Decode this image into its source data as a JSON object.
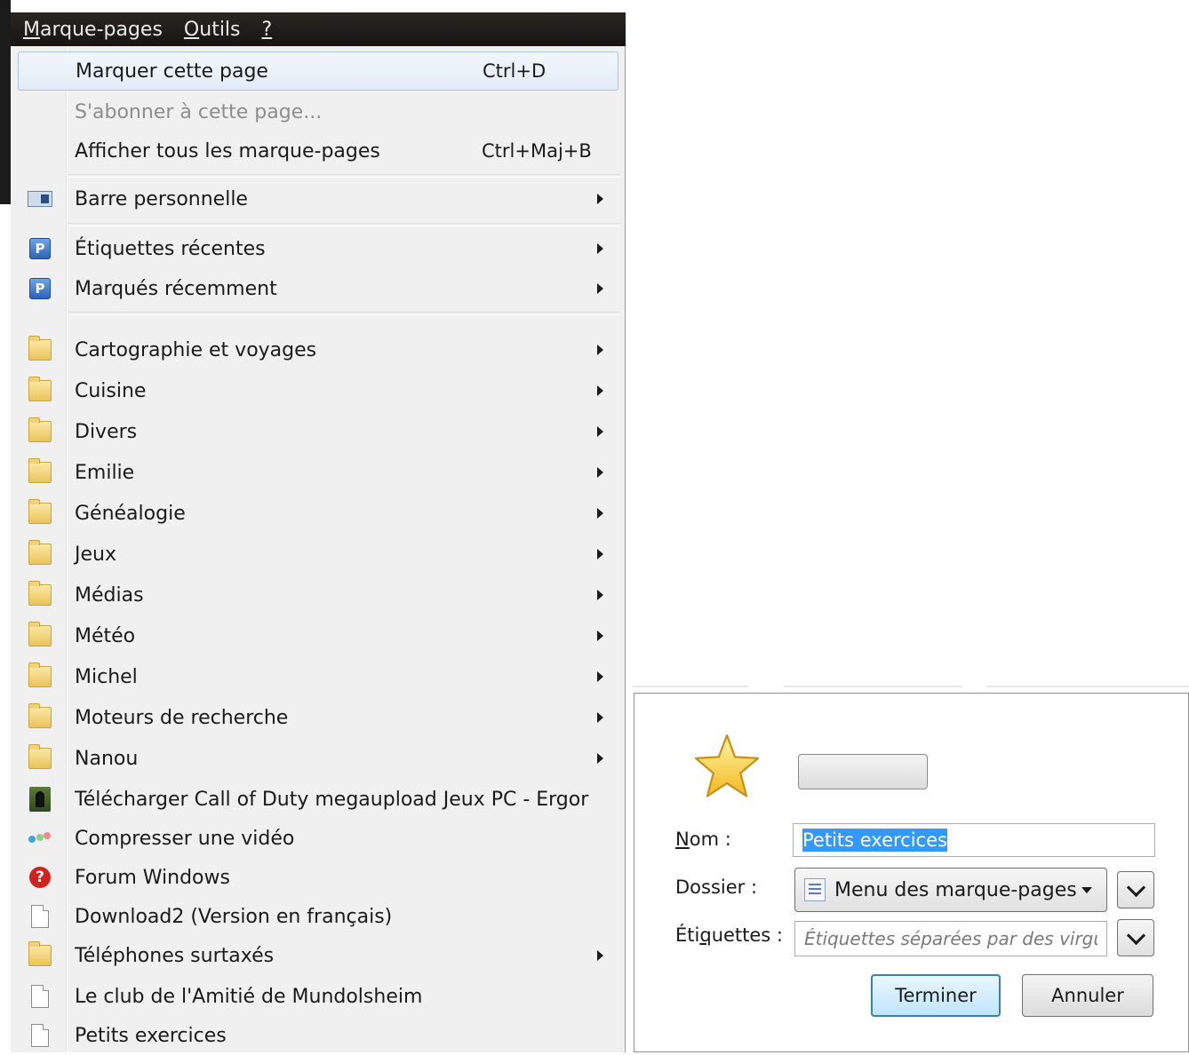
{
  "menubar": {
    "items": [
      {
        "label": "Marque-pages",
        "accel": "M"
      },
      {
        "label": "Outils",
        "accel": "O"
      },
      {
        "label": "?",
        "accel": "?"
      }
    ]
  },
  "menu": {
    "top": [
      {
        "label": "Marquer cette page",
        "shortcut": "Ctrl+D"
      },
      {
        "label": "S'abonner à cette page..."
      },
      {
        "label": "Afficher tous les marque-pages",
        "shortcut": "Ctrl+Maj+B"
      },
      {
        "label": "Barre personnelle"
      },
      {
        "label": "Étiquettes récentes"
      },
      {
        "label": "Marqués récemment"
      }
    ],
    "folders": [
      {
        "label": "Cartographie et voyages"
      },
      {
        "label": "Cuisine"
      },
      {
        "label": "Divers"
      },
      {
        "label": "Emilie"
      },
      {
        "label": "Généalogie"
      },
      {
        "label": "Jeux"
      },
      {
        "label": "Médias"
      },
      {
        "label": "Météo"
      },
      {
        "label": "Michel"
      },
      {
        "label": "Moteurs de recherche"
      },
      {
        "label": "Nanou"
      }
    ],
    "bookmarks": [
      {
        "label": "Télécharger Call of Duty megaupload Jeux PC - Ergor",
        "icon": "person-icon"
      },
      {
        "label": "Compresser une vidéo",
        "icon": "dots-icon"
      },
      {
        "label": "Forum Windows",
        "icon": "forum-icon"
      },
      {
        "label": "Download2 (Version en français)",
        "icon": "page-icon"
      },
      {
        "label": "Téléphones surtaxés",
        "icon": "folder-icon"
      },
      {
        "label": "Le club de l'Amitié de Mundolsheim",
        "icon": "page-icon"
      },
      {
        "label": "Petits exercices",
        "icon": "page-icon"
      }
    ]
  },
  "dialog": {
    "name_label": "Nom :",
    "name_value": "Petits exercices",
    "folder_label": "Dossier :",
    "folder_value": "Menu des marque-pages",
    "tags_label": "Étiquettes :",
    "tags_placeholder": "Étiquettes séparées par des virgules",
    "done_button": "Terminer",
    "cancel_button": "Annuler"
  },
  "colors": {
    "menubar": "#1e1a17",
    "menu_bg": "#f0f0f0",
    "highlight_border": "#a9c4e6",
    "selection": "#3399ff",
    "star": "#f7cf2e"
  }
}
